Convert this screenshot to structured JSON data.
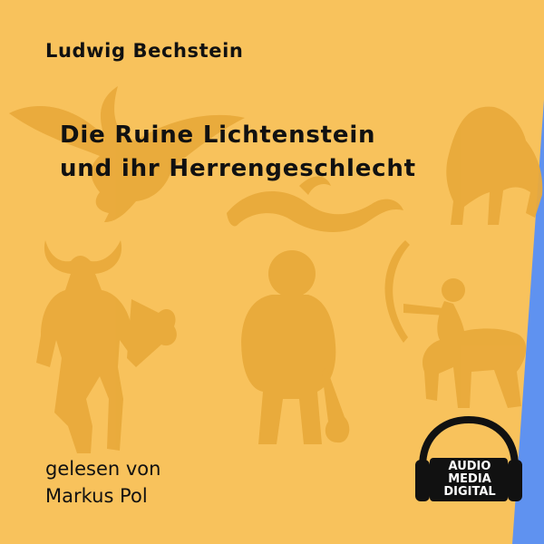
{
  "cover": {
    "author": "Ludwig Bechstein",
    "title_lines": [
      "Die Ruine Lichtenstein",
      "und ihr Herrengeschlecht"
    ],
    "reader_label": "gelesen von",
    "reader_name": "Markus Pol"
  },
  "logo": {
    "lines": [
      "AUDIO",
      "MEDIA",
      "DIGITAL"
    ]
  },
  "colors": {
    "background": "#f8c25c",
    "side_stripe": "#5f92f0",
    "figures": "#e8a93a",
    "text": "#111111"
  }
}
